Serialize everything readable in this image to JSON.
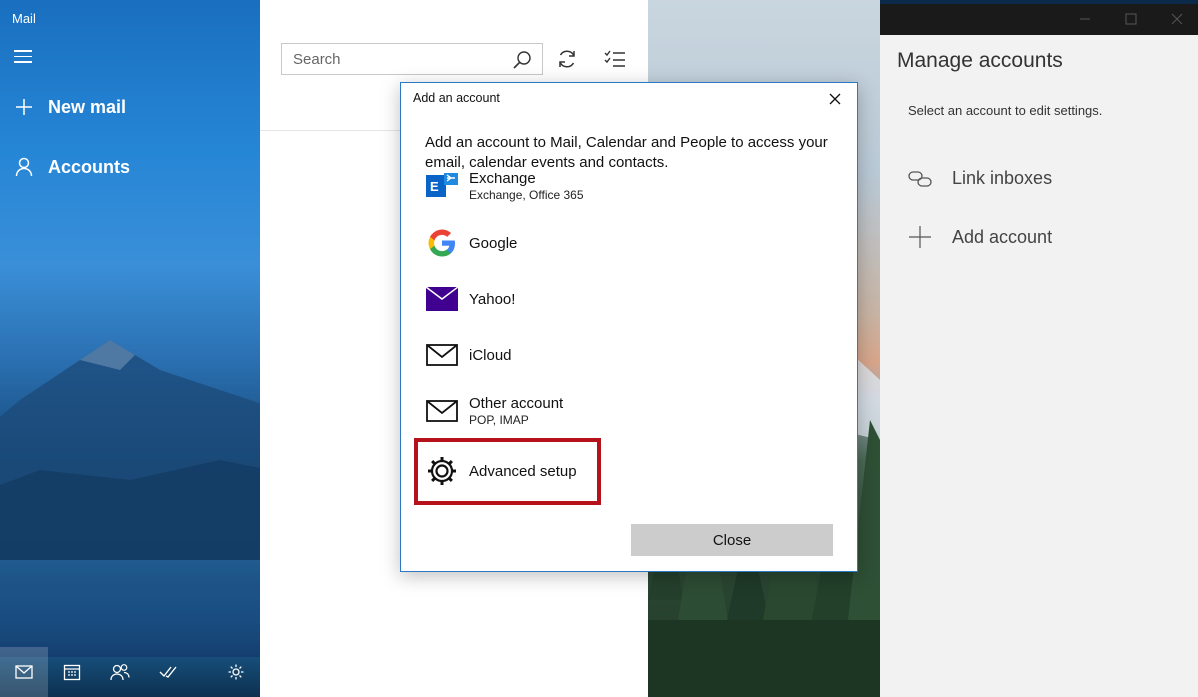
{
  "app": {
    "title": "Mail"
  },
  "nav": {
    "new_mail": "New mail",
    "accounts": "Accounts"
  },
  "bottom_bar": [
    "mail-icon",
    "calendar-icon",
    "people-icon",
    "todo-icon",
    "settings-icon"
  ],
  "search": {
    "placeholder": "Search"
  },
  "manage": {
    "title": "Manage accounts",
    "subtitle": "Select an account to edit settings.",
    "link_inboxes": "Link inboxes",
    "add_account": "Add account"
  },
  "dialog": {
    "title": "Add an account",
    "intro": "Add an account to Mail, Calendar and People to access your email, calendar events and contacts.",
    "accounts": [
      {
        "name": "Exchange",
        "desc": "Exchange, Office 365"
      },
      {
        "name": "Google",
        "desc": ""
      },
      {
        "name": "Yahoo!",
        "desc": ""
      },
      {
        "name": "iCloud",
        "desc": ""
      },
      {
        "name": "Other account",
        "desc": "POP, IMAP"
      },
      {
        "name": "Advanced setup",
        "desc": ""
      }
    ],
    "close_label": "Close"
  },
  "colors": {
    "accent": "#2686d6",
    "highlight": "#b5121b",
    "yahoo": "#400090"
  }
}
